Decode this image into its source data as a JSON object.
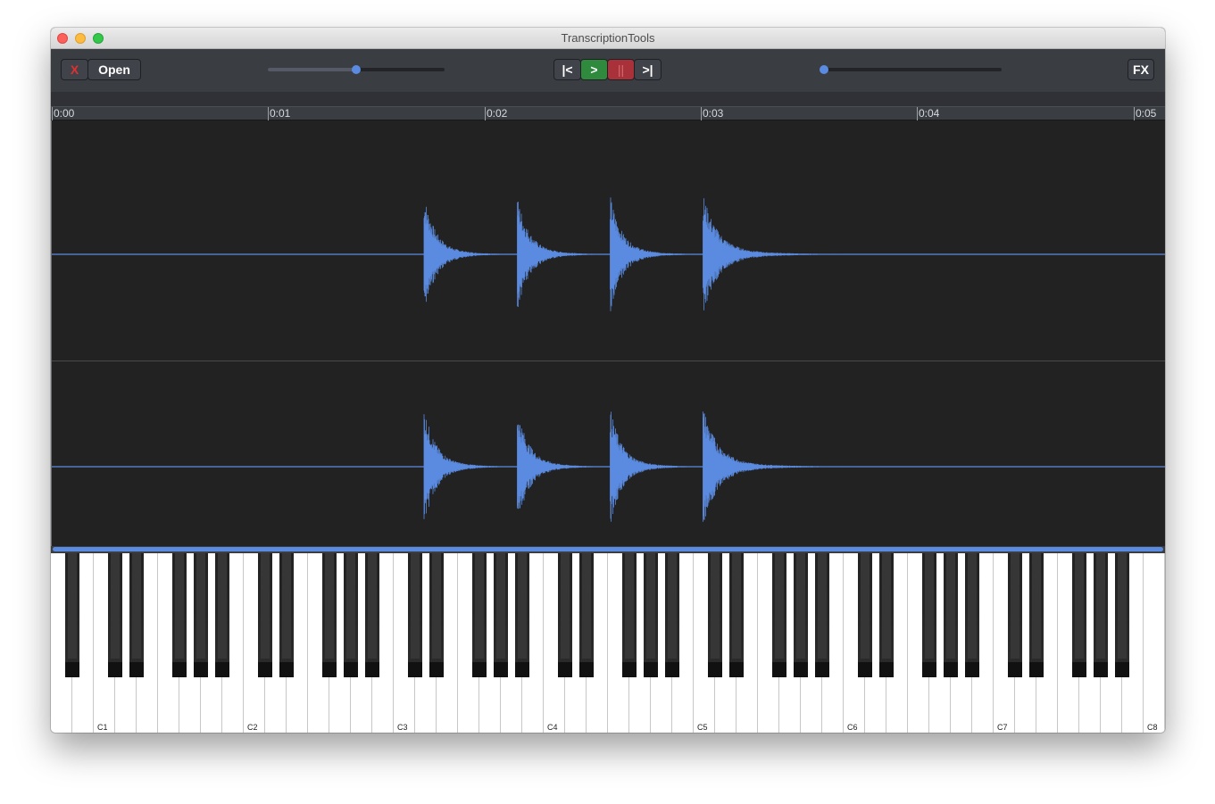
{
  "window": {
    "title": "TranscriptionTools"
  },
  "toolbar": {
    "close_label": "X",
    "open_label": "Open",
    "prev_label": "|<",
    "play_label": ">",
    "pause_label": "||",
    "next_label": ">|",
    "fx_label": "FX",
    "speed_slider": {
      "value": 0.5
    },
    "position_slider": {
      "value": 0.0
    }
  },
  "timeline": {
    "ticks": [
      "0:00",
      "0:01",
      "0:02",
      "0:03",
      "0:04",
      "0:05"
    ],
    "duration_seconds": 5.15
  },
  "waveform": {
    "channels": 2,
    "onsets_seconds": [
      1.72,
      2.15,
      2.58,
      3.01
    ],
    "decay_end_seconds": 3.7
  },
  "piano": {
    "octave_labels": [
      "C1",
      "C2",
      "C3",
      "C4",
      "C5",
      "C6",
      "C7",
      "C8"
    ]
  },
  "colors": {
    "accent": "#5b8be0",
    "play": "#2f8a3e",
    "pause": "#a9323a",
    "waveform_bg": "#222222"
  }
}
